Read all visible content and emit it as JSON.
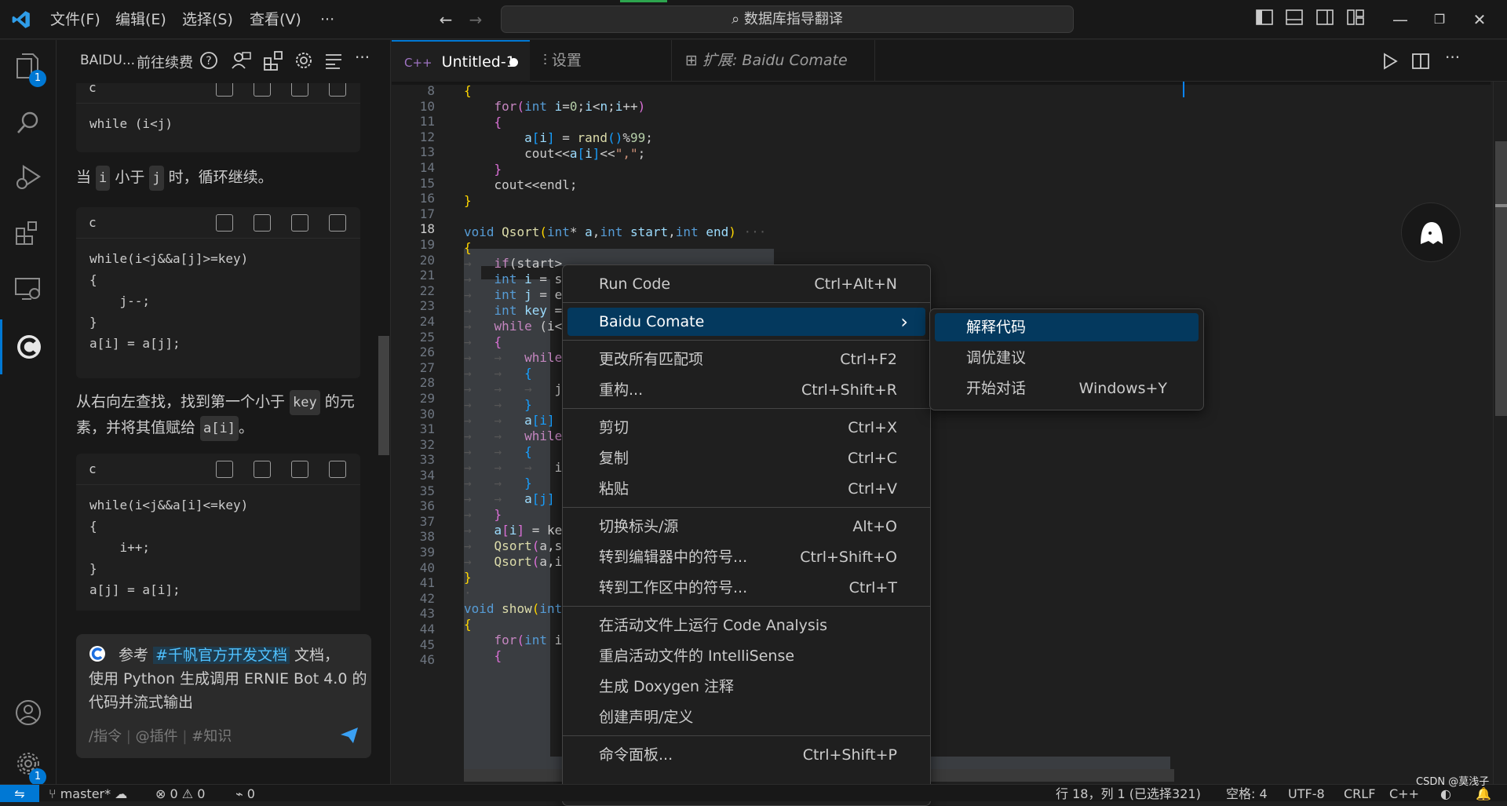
{
  "menubar": {
    "file": "文件(F)",
    "edit": "编辑(E)",
    "selection": "选择(S)",
    "view": "查看(V)",
    "more": "···"
  },
  "command_center": {
    "text": "数据库指导翻译"
  },
  "activity": {
    "explorer_badge": "1",
    "settings_badge": "1"
  },
  "sidebar": {
    "title": "BAIDU...",
    "renew": "前往续费",
    "blocks": [
      {
        "lang": "c",
        "code": "while (i<j)"
      },
      {
        "lang": "c",
        "code": "while(i<j&&a[j]>=key)\n{\n    j--;\n}\na[i] = a[j];"
      },
      {
        "lang": "c",
        "code": "while(i<j&&a[i]<=key)\n{\n    i++;\n}\na[j] = a[i];"
      }
    ],
    "para1": {
      "a": "当 ",
      "code1": "i",
      "b": " 小于 ",
      "code2": "j",
      "c": " 时，循环继续。"
    },
    "para2": {
      "a": "从右向左查找，找到第一个小于 ",
      "code1": "key",
      "b": " 的元素，并将其值赋给 ",
      "code2": "a[i]",
      "c": "。"
    },
    "chat": {
      "ref_pre": "参考 ",
      "ref_link": "#千帆官方开发文档",
      "ref_post": " 文档，",
      "line2": "使用 Python 生成调用 ERNIE Bot 4.0 的",
      "line3": "代码并流式输出",
      "cmd": "/指令",
      "plugin": "@插件",
      "knowledge": "#知识"
    }
  },
  "tabs": [
    {
      "label": "Untitled-1",
      "icon": "C++"
    },
    {
      "label": "设置"
    },
    {
      "label": "扩展: Baidu Comate"
    }
  ],
  "editor": {
    "line_numbers": [
      "8",
      "10",
      "11",
      "12",
      "13",
      "14",
      "15",
      "16",
      "17",
      "18",
      "19",
      "20",
      "21",
      "22",
      "23",
      "24",
      "25",
      "26",
      "27",
      "28",
      "29",
      "30",
      "31",
      "32",
      "33",
      "34",
      "35",
      "36",
      "37",
      "38",
      "39",
      "40",
      "41",
      "42",
      "43",
      "44",
      "45",
      "46"
    ]
  },
  "context_menu": {
    "groups": [
      [
        {
          "label": "Run Code",
          "key": "Ctrl+Alt+N"
        }
      ],
      [
        {
          "label": "Baidu Comate",
          "key": "›",
          "active": true
        }
      ],
      [
        {
          "label": "更改所有匹配项",
          "key": "Ctrl+F2"
        },
        {
          "label": "重构...",
          "key": "Ctrl+Shift+R"
        }
      ],
      [
        {
          "label": "剪切",
          "key": "Ctrl+X"
        },
        {
          "label": "复制",
          "key": "Ctrl+C"
        },
        {
          "label": "粘贴",
          "key": "Ctrl+V"
        }
      ],
      [
        {
          "label": "切换标头/源",
          "key": "Alt+O"
        },
        {
          "label": "转到编辑器中的符号...",
          "key": "Ctrl+Shift+O"
        },
        {
          "label": "转到工作区中的符号...",
          "key": "Ctrl+T"
        }
      ],
      [
        {
          "label": "在活动文件上运行 Code Analysis",
          "key": ""
        },
        {
          "label": "重启活动文件的 IntelliSense",
          "key": ""
        },
        {
          "label": "生成 Doxygen 注释",
          "key": ""
        },
        {
          "label": "创建声明/定义",
          "key": ""
        }
      ],
      [
        {
          "label": "命令面板...",
          "key": "Ctrl+Shift+P"
        }
      ]
    ]
  },
  "submenu": [
    {
      "label": "解释代码",
      "key": "",
      "active": true
    },
    {
      "label": "调优建议",
      "key": ""
    },
    {
      "label": "开始对话",
      "key": "Windows+Y"
    }
  ],
  "status": {
    "branch": "master*",
    "errors": "0",
    "warnings": "0",
    "ports": "0",
    "position": "行 18，列 1 (已选择321)",
    "spaces": "空格: 4",
    "encoding": "UTF-8",
    "eol": "CRLF",
    "lang": "C++",
    "watermark": "CSDN @莫浅子"
  },
  "colors": {
    "accent": "#0078d4",
    "menu_active": "#04395e"
  }
}
